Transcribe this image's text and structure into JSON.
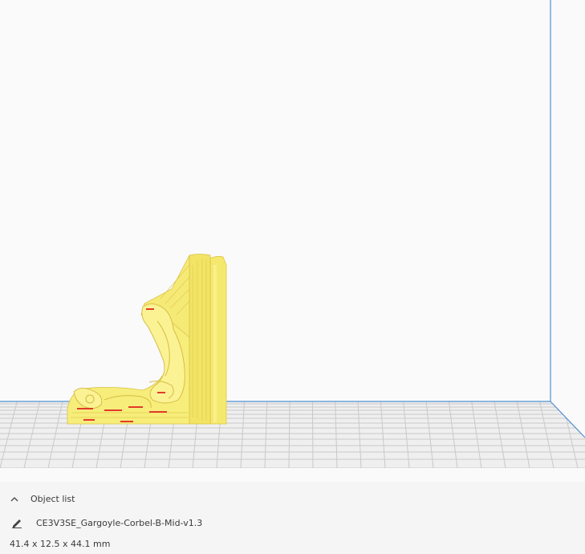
{
  "object_list": {
    "title": "Object list",
    "collapse_icon": "chevron-up-icon",
    "edit_icon": "pencil-icon",
    "object_name": "CE3V3SE_Gargoyle-Corbel-B-Mid-v1.3",
    "dimensions": "41.4 x 12.5 x 44.1 mm"
  },
  "colors": {
    "model": "#f7ed7a",
    "model_shade": "#e0c845",
    "model_overhang": "#e23a2a",
    "volume_edge": "#4f8fd4",
    "grid_line": "#c8c8c8",
    "plate": "#f0f0f0",
    "background": "#fafafa"
  }
}
